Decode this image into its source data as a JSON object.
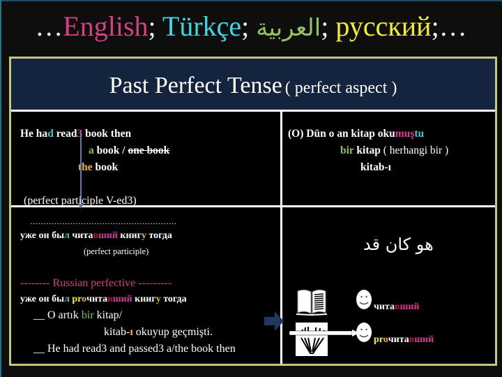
{
  "title_bar": {
    "prefix": "…",
    "english": "English",
    "sep1": "; ",
    "turkish": "Türkçe",
    "sep2": "; ",
    "arabic": "العربية",
    "sep3": "; ",
    "russian": "русский",
    "suffix": ";…"
  },
  "header": {
    "title": "Past Perfect Tense",
    "subtitle": "( perfect aspect )"
  },
  "colors": {
    "english": "#d8407f",
    "turkish": "#3ed8e0",
    "arabic": "#96c25a",
    "russian": "#f2ee2a",
    "header_bg": "#14243f",
    "table_border": "#c8c67c"
  },
  "english_cell": {
    "line1": {
      "a": "He ha",
      "b": "d",
      "c": " read",
      "d": "3",
      "e": "  book  then"
    },
    "line2": {
      "a": "a",
      "b": " book / ",
      "c": "one book "
    },
    "line3": {
      "a": "the",
      "b": " book"
    },
    "note": "(perfect participle V-ed3)"
  },
  "turkish_cell": {
    "line1": {
      "a": "(O) Dün o an  kitap  oku",
      "b": "muş",
      "c": "tu"
    },
    "line2": {
      "a": "bir",
      "b": " kitap ",
      "c": "( herhangi bir )"
    },
    "line3": "kitab-ı"
  },
  "russian_cell": {
    "dots": "……………………………………………….",
    "sentence": {
      "a": "уже он бы",
      "b": "л",
      "c": "  чита",
      "d": "в",
      "e": "ший",
      "f": "  книг",
      "g": "у",
      "h": "  тогда"
    },
    "note": "(perfect participle)"
  },
  "arabic_cell": {
    "text": "هو كان قد"
  },
  "perfective_cell": {
    "heading": "-------- Russian perfective ---------",
    "sentence": {
      "a": "уже он бы",
      "b": "л",
      "c": "  ",
      "d": "pr",
      "e": "o",
      "f": "чита",
      "g": "в",
      "h": "ший",
      "i": "  книг",
      "j": "у",
      "k": "  тогда"
    },
    "tr_line1": {
      "a": "__ O artık ",
      "b": "bir",
      "c": " kitap/"
    },
    "tr_line2": {
      "a": "kitab-",
      "b": "ı",
      "c": " okuyup geçmişti."
    },
    "en_line": "__ He had read3  and passed3 a/the book then"
  },
  "illustration_cell": {
    "word1": {
      "a": "чита",
      "b": "в",
      "c": "ший"
    },
    "word2": {
      "a": "pr",
      "b": "o",
      "c": "чита",
      "d": "в",
      "e": "ший"
    },
    "icons": [
      "open-book-icon",
      "hand-icon",
      "smiley-icon",
      "smiley-icon",
      "right-arrow-icon"
    ]
  }
}
